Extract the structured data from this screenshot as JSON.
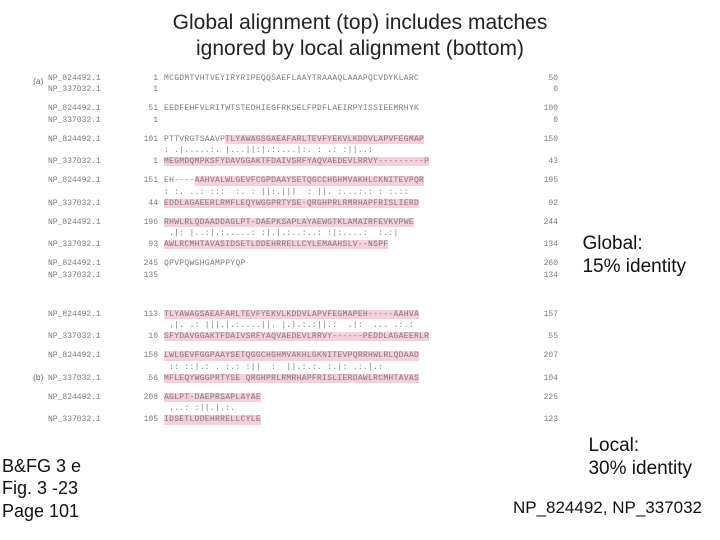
{
  "title_line1": "Global alignment (top) includes matches",
  "title_line2": "ignored by local alignment (bottom)",
  "panel_a_label": "(a)",
  "panel_b_label": "(b)",
  "global_anno_line1": "Global:",
  "global_anno_line2": "15% identity",
  "local_anno_line1": "Local:",
  "local_anno_line2": "30% identity",
  "ref_line1": "B&FG 3 e",
  "ref_line2": "Fig. 3 -23",
  "ref_line3": "Page 101",
  "np_ids": "NP_824492, NP_337032",
  "acc1": "NP_824492.1",
  "acc2": "NP_337032.1",
  "a_blocks": [
    {
      "r1": {
        "start": "1",
        "seq_plain": "MCGDMTVHTVEYIRYRIPEQQSAEFLAAYTRAAAQLAAAPQCVDYKLARC",
        "end": "50"
      },
      "r2": {
        "start": "1",
        "seq_plain": "",
        "end": "0"
      }
    },
    {
      "r1": {
        "start": "51",
        "seq_plain": "EEDFEHFVLRITWTSTEDHIEGFRKSELFPDFLAEIRPYISSIEEMRHYK",
        "end": "100"
      },
      "r2": {
        "start": "1",
        "seq_plain": "",
        "end": "0"
      }
    },
    {
      "r1": {
        "start": "101",
        "seq_pre": "PTTVRGTSAAVP",
        "seq_hl": "TLYAWAGSGAEAFARLTEVFYEKVLKDDVLAPVFEGMAP",
        "end": "150"
      },
      "match": ": .|.....:. |...||:|.:....|:. : .: :||..: ",
      "r2": {
        "start": "1",
        "seq_pre": "",
        "seq_hl": "MEGMDQMPKSFYDAVGGAKTFDAIVSRFYAQVAEDEVLRRVY---------P",
        "end": "43"
      }
    },
    {
      "r1": {
        "start": "151",
        "seq_pre": "EH----",
        "seq_hl": "AAHVALWLGEVFCGPDAAYSETQGCCHGHMVAKHLCKNITEVPQR",
        "end": "195"
      },
      "match": ": :. ..: :::  :. : ||:.|||  : ||. :...:.: : :.::",
      "r2": {
        "start": "44",
        "seq_pre": "",
        "seq_hl": "EDDLAGAEERLRMFLEQYWGGPRTYSE-QRGHPRLRMRHAPFRISLIERD",
        "end": "92"
      }
    },
    {
      "r1": {
        "start": "196",
        "seq_pre": "",
        "seq_hl": "RHWLRLQDAADDAGLPT-DAEPKSAPLAYAEWGTKLAMAIRFEVKVPWE",
        "end": "244"
      },
      "match": " .|: |..:|.:.....: :|.|.:..:..: :|:....:  :.:|",
      "r2": {
        "start": "93",
        "seq_pre": "",
        "seq_hl": "AWLRCMHTAVASIDSETLDDEHRRELLCYLEMAAHSLV--NSPF",
        "end": "134"
      }
    },
    {
      "r1": {
        "start": "245",
        "seq_plain": "QPVPQWSHGAMPPYQP",
        "end": "260"
      },
      "r2": {
        "start": "135",
        "seq_plain": "",
        "end": "134"
      }
    }
  ],
  "b_blocks": [
    {
      "r1": {
        "start": "113",
        "seq_hl": "TLYAWAGSAEAFARLTEVFYEKVLKDDVLAPVFEGMAPEH-----AAHVA",
        "end": "157"
      },
      "match": " .|. .: |||.|.:....||. |.|.:.:||.:  .|:  ... .:.:",
      "r2": {
        "start": "10",
        "seq_hl": "SFYDAVGGAKTFDAIVSRFYAQVAEDEVLRRVY------PEDDLAGAEERLR",
        "end": "55"
      }
    },
    {
      "r1": {
        "start": "158",
        "seq_hl": "LWLGEVFGGPAAYSETQGGCHGHMVAKHLGKNITEVPQRRHWLRLQDAAD",
        "end": "207"
      },
      "match": " :: ::|.: . :.: :||  :  ||.:.:. :.|: .:.|.:",
      "r2": {
        "start": "56",
        "seq_hl": "MFLEQYWGGPRTYSE QRGHPRLRMRHAPFRISLIERDAWLRCMHTAVAS",
        "end": "104"
      }
    },
    {
      "r1": {
        "start": "208",
        "seq_hl": "AGLPT-DAEPRSAPLAYAE",
        "seq_post": "",
        "end": "225"
      },
      "match": " ...: :||.|.:.",
      "r2": {
        "start": "105",
        "seq_hl": "IDSETLDDEHRRELLCYLE",
        "seq_post": "",
        "end": "123"
      }
    }
  ]
}
